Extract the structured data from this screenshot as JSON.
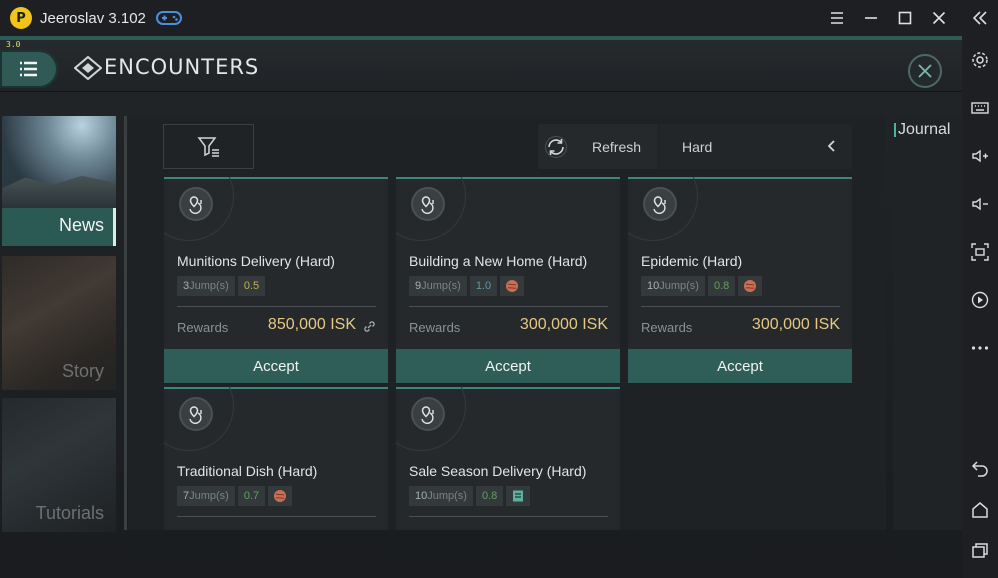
{
  "window": {
    "title": "Jeeroslav 3.102",
    "logo_letter": "P"
  },
  "hud": {
    "fps_text": "3.0"
  },
  "header": {
    "title": "ENCOUNTERS"
  },
  "categories": [
    {
      "label": "News",
      "selected": true
    },
    {
      "label": "Story",
      "selected": false
    },
    {
      "label": "Tutorials",
      "selected": false
    }
  ],
  "toolbar": {
    "refresh_label": "Refresh",
    "difficulty_label": "Hard"
  },
  "cards": [
    {
      "title": "Munitions Delivery (Hard)",
      "jumps": "3",
      "jumps_suffix": "Jump(s)",
      "security": "0.5",
      "rewards_label": "Rewards",
      "reward": "850,000 ISK",
      "accept_label": "Accept"
    },
    {
      "title": "Building a New Home (Hard)",
      "jumps": "9",
      "jumps_suffix": "Jump(s)",
      "security": "1.0",
      "rewards_label": "Rewards",
      "reward": "300,000 ISK",
      "accept_label": "Accept"
    },
    {
      "title": "Epidemic (Hard)",
      "jumps": "10",
      "jumps_suffix": "Jump(s)",
      "security": "0.8",
      "rewards_label": "Rewards",
      "reward": "300,000 ISK",
      "accept_label": "Accept"
    },
    {
      "title": "Traditional Dish (Hard)",
      "jumps": "7",
      "jumps_suffix": "Jump(s)",
      "security": "0.7"
    },
    {
      "title": "Sale Season Delivery (Hard)",
      "jumps": "10",
      "jumps_suffix": "Jump(s)",
      "security": "0.8"
    }
  ],
  "journal": {
    "label": "Journal"
  },
  "colors": {
    "accent": "#2e5e57",
    "reward": "#e6c884",
    "fps": "#d7e36a"
  },
  "icons": {
    "window": [
      "gamepad-icon",
      "menu-icon",
      "minimize-icon",
      "maximize-icon",
      "close-icon",
      "collapse-icon"
    ],
    "sidebar": [
      "settings-icon",
      "keyboard-icon",
      "volume-up-icon",
      "volume-down-icon",
      "screenshot-icon",
      "record-icon",
      "more-icon",
      "back-icon",
      "home-icon",
      "recents-icon"
    ]
  }
}
